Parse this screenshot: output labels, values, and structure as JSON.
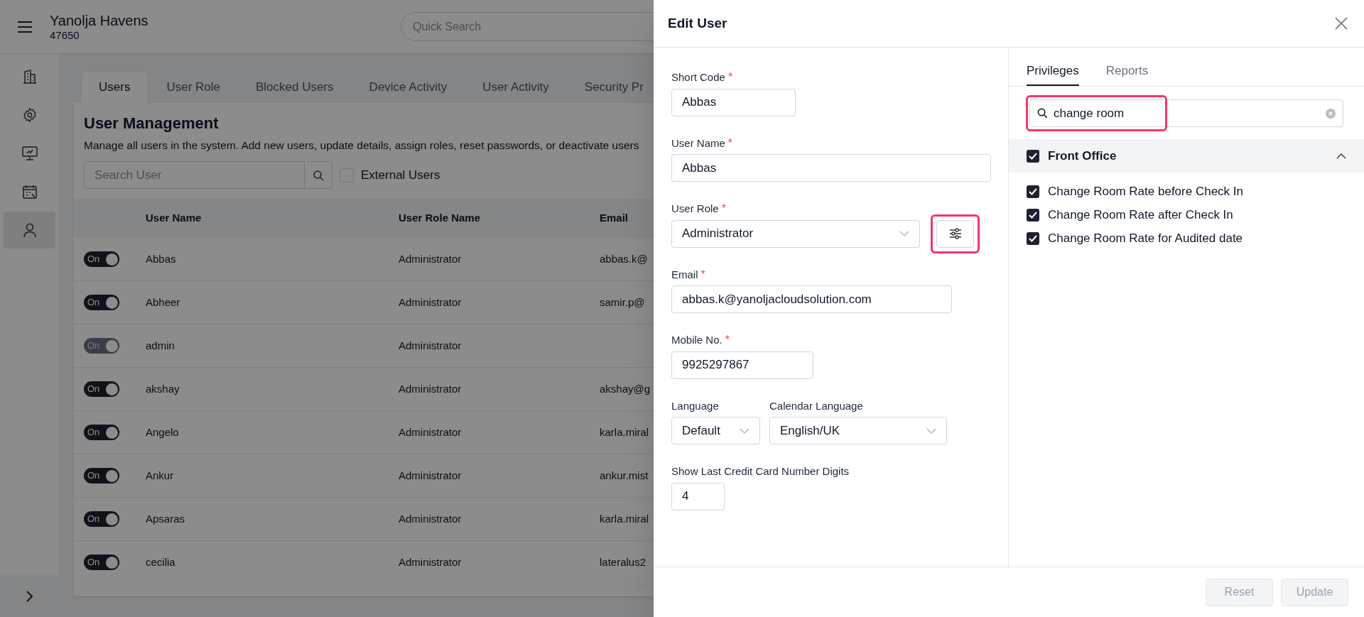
{
  "app": {
    "title": "Yanolja Havens",
    "code": "47650",
    "quick_search_placeholder": "Quick Search"
  },
  "sidebar": {
    "items": [
      {
        "selected": false
      },
      {
        "selected": false
      },
      {
        "selected": false
      },
      {
        "selected": false
      },
      {
        "selected": true
      }
    ]
  },
  "tabs": [
    {
      "label": "Users",
      "selected": true
    },
    {
      "label": "User Role",
      "selected": false
    },
    {
      "label": "Blocked Users",
      "selected": false
    },
    {
      "label": "Device Activity",
      "selected": false
    },
    {
      "label": "User Activity",
      "selected": false
    },
    {
      "label": "Security Pr",
      "selected": false
    }
  ],
  "page": {
    "heading": "User Management",
    "description": "Manage all users in the system. Add new users, update details, assign roles, reset passwords, or deactivate users",
    "search_placeholder": "Search User",
    "external_users": {
      "label": "External Users",
      "checked": false
    }
  },
  "table": {
    "columns": [
      "User Name",
      "User Role Name",
      "Email"
    ],
    "rows": [
      {
        "toggle": "On",
        "on": true,
        "disabled": false,
        "user_name": "Abbas",
        "role": "Administrator",
        "email": "abbas.k@"
      },
      {
        "toggle": "On",
        "on": true,
        "disabled": false,
        "user_name": "Abheer",
        "role": "Administrator",
        "email": "samir.p@"
      },
      {
        "toggle": "On",
        "on": true,
        "disabled": true,
        "user_name": "admin",
        "role": "Administrator",
        "email": ""
      },
      {
        "toggle": "On",
        "on": true,
        "disabled": false,
        "user_name": "akshay",
        "role": "Administrator",
        "email": "akshay@g"
      },
      {
        "toggle": "On",
        "on": true,
        "disabled": false,
        "user_name": "Angelo",
        "role": "Administrator",
        "email": "karla.miral"
      },
      {
        "toggle": "On",
        "on": true,
        "disabled": false,
        "user_name": "Ankur",
        "role": "Administrator",
        "email": "ankur.mist"
      },
      {
        "toggle": "On",
        "on": true,
        "disabled": false,
        "user_name": "Apsaras",
        "role": "Administrator",
        "email": "karla.miral"
      },
      {
        "toggle": "On",
        "on": true,
        "disabled": false,
        "user_name": "cecilia",
        "role": "Administrator",
        "email": "lateralus2"
      }
    ]
  },
  "edit_user": {
    "title": "Edit User",
    "form": [
      [
        {
          "kind": "text",
          "label": "Short Code",
          "required_mark": "*",
          "value": "Abbas"
        }
      ],
      [
        {
          "kind": "text",
          "label": "User Name",
          "required_mark": "*",
          "value": "Abbas"
        }
      ],
      [
        {
          "kind": "role_select",
          "label": "User Role",
          "required_mark": "*",
          "value": "Administrator",
          "highlighted": true
        }
      ],
      [
        {
          "kind": "text",
          "label": "Email",
          "required_mark": "*",
          "value": "abbas.k@yanoljacloudsolution.com"
        }
      ],
      [
        {
          "kind": "text",
          "label": "Mobile No.",
          "required_mark": "*",
          "value": "9925297867"
        }
      ],
      [
        {
          "kind": "select",
          "label": "Language",
          "value": "Default"
        },
        {
          "kind": "select",
          "label": "Calendar Language",
          "value": "English/UK"
        }
      ],
      [
        {
          "kind": "text",
          "label": "Show Last Credit Card Number Digits",
          "value": "4"
        }
      ]
    ],
    "buttons": [
      {
        "label": "Reset",
        "disabled": true
      },
      {
        "label": "Update",
        "disabled": true
      }
    ]
  },
  "privileges_panel": {
    "tabs": [
      {
        "label": "Privileges",
        "selected": true
      },
      {
        "label": "Reports",
        "selected": false
      }
    ],
    "search": {
      "value": "change room",
      "highlighted": true
    },
    "groups": [
      {
        "label": "Front Office",
        "checked": true,
        "expanded": true,
        "items": [
          {
            "label": "Change Room Rate before Check In",
            "checked": true
          },
          {
            "label": "Change Room Rate after Check In",
            "checked": true
          },
          {
            "label": "Change Room Rate for Audited date",
            "checked": true
          }
        ]
      }
    ]
  }
}
